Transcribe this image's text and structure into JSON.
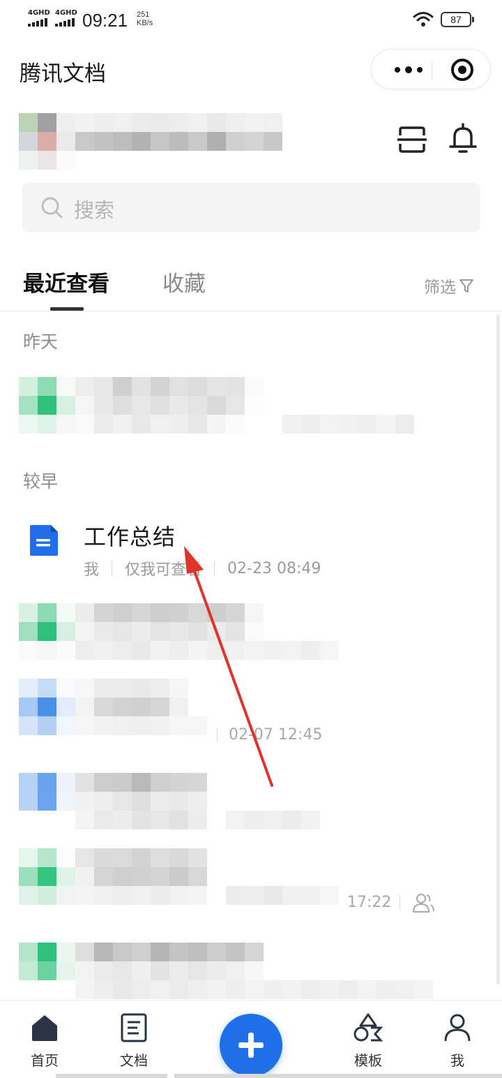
{
  "status_bar": {
    "sim1": "4GHD",
    "sim2": "4GHD",
    "time": "09:21",
    "net_rate_value": "251",
    "net_rate_unit": "KB/s",
    "battery": "87"
  },
  "header": {
    "title": "腾讯文档"
  },
  "search": {
    "placeholder": "搜索"
  },
  "tabs": {
    "recent": "最近查看",
    "favorites": "收藏",
    "filter": "筛选"
  },
  "sections": {
    "yesterday": "昨天",
    "earlier": "较早"
  },
  "document": {
    "title": "工作总结",
    "owner": "我",
    "permission": "仅我可查看",
    "time": "02-23 08:49"
  },
  "blurred_rows": {
    "row3_time": "02-07 12:45",
    "row5_time": "17:22"
  },
  "bottom_nav": {
    "home": "首页",
    "docs": "文档",
    "templates": "模板",
    "me": "我"
  },
  "colors": {
    "accent": "#1e6fe8",
    "doc_icon": "#1f6fec",
    "annotation_arrow": "#e0342b"
  },
  "icons": {
    "more": "more-dots-icon",
    "target": "target-icon",
    "scan": "scan-icon",
    "bell": "bell-icon",
    "search": "search-icon",
    "filter": "filter-icon",
    "doc": "word-doc-icon",
    "share": "shared-users-icon",
    "add": "plus-icon"
  }
}
